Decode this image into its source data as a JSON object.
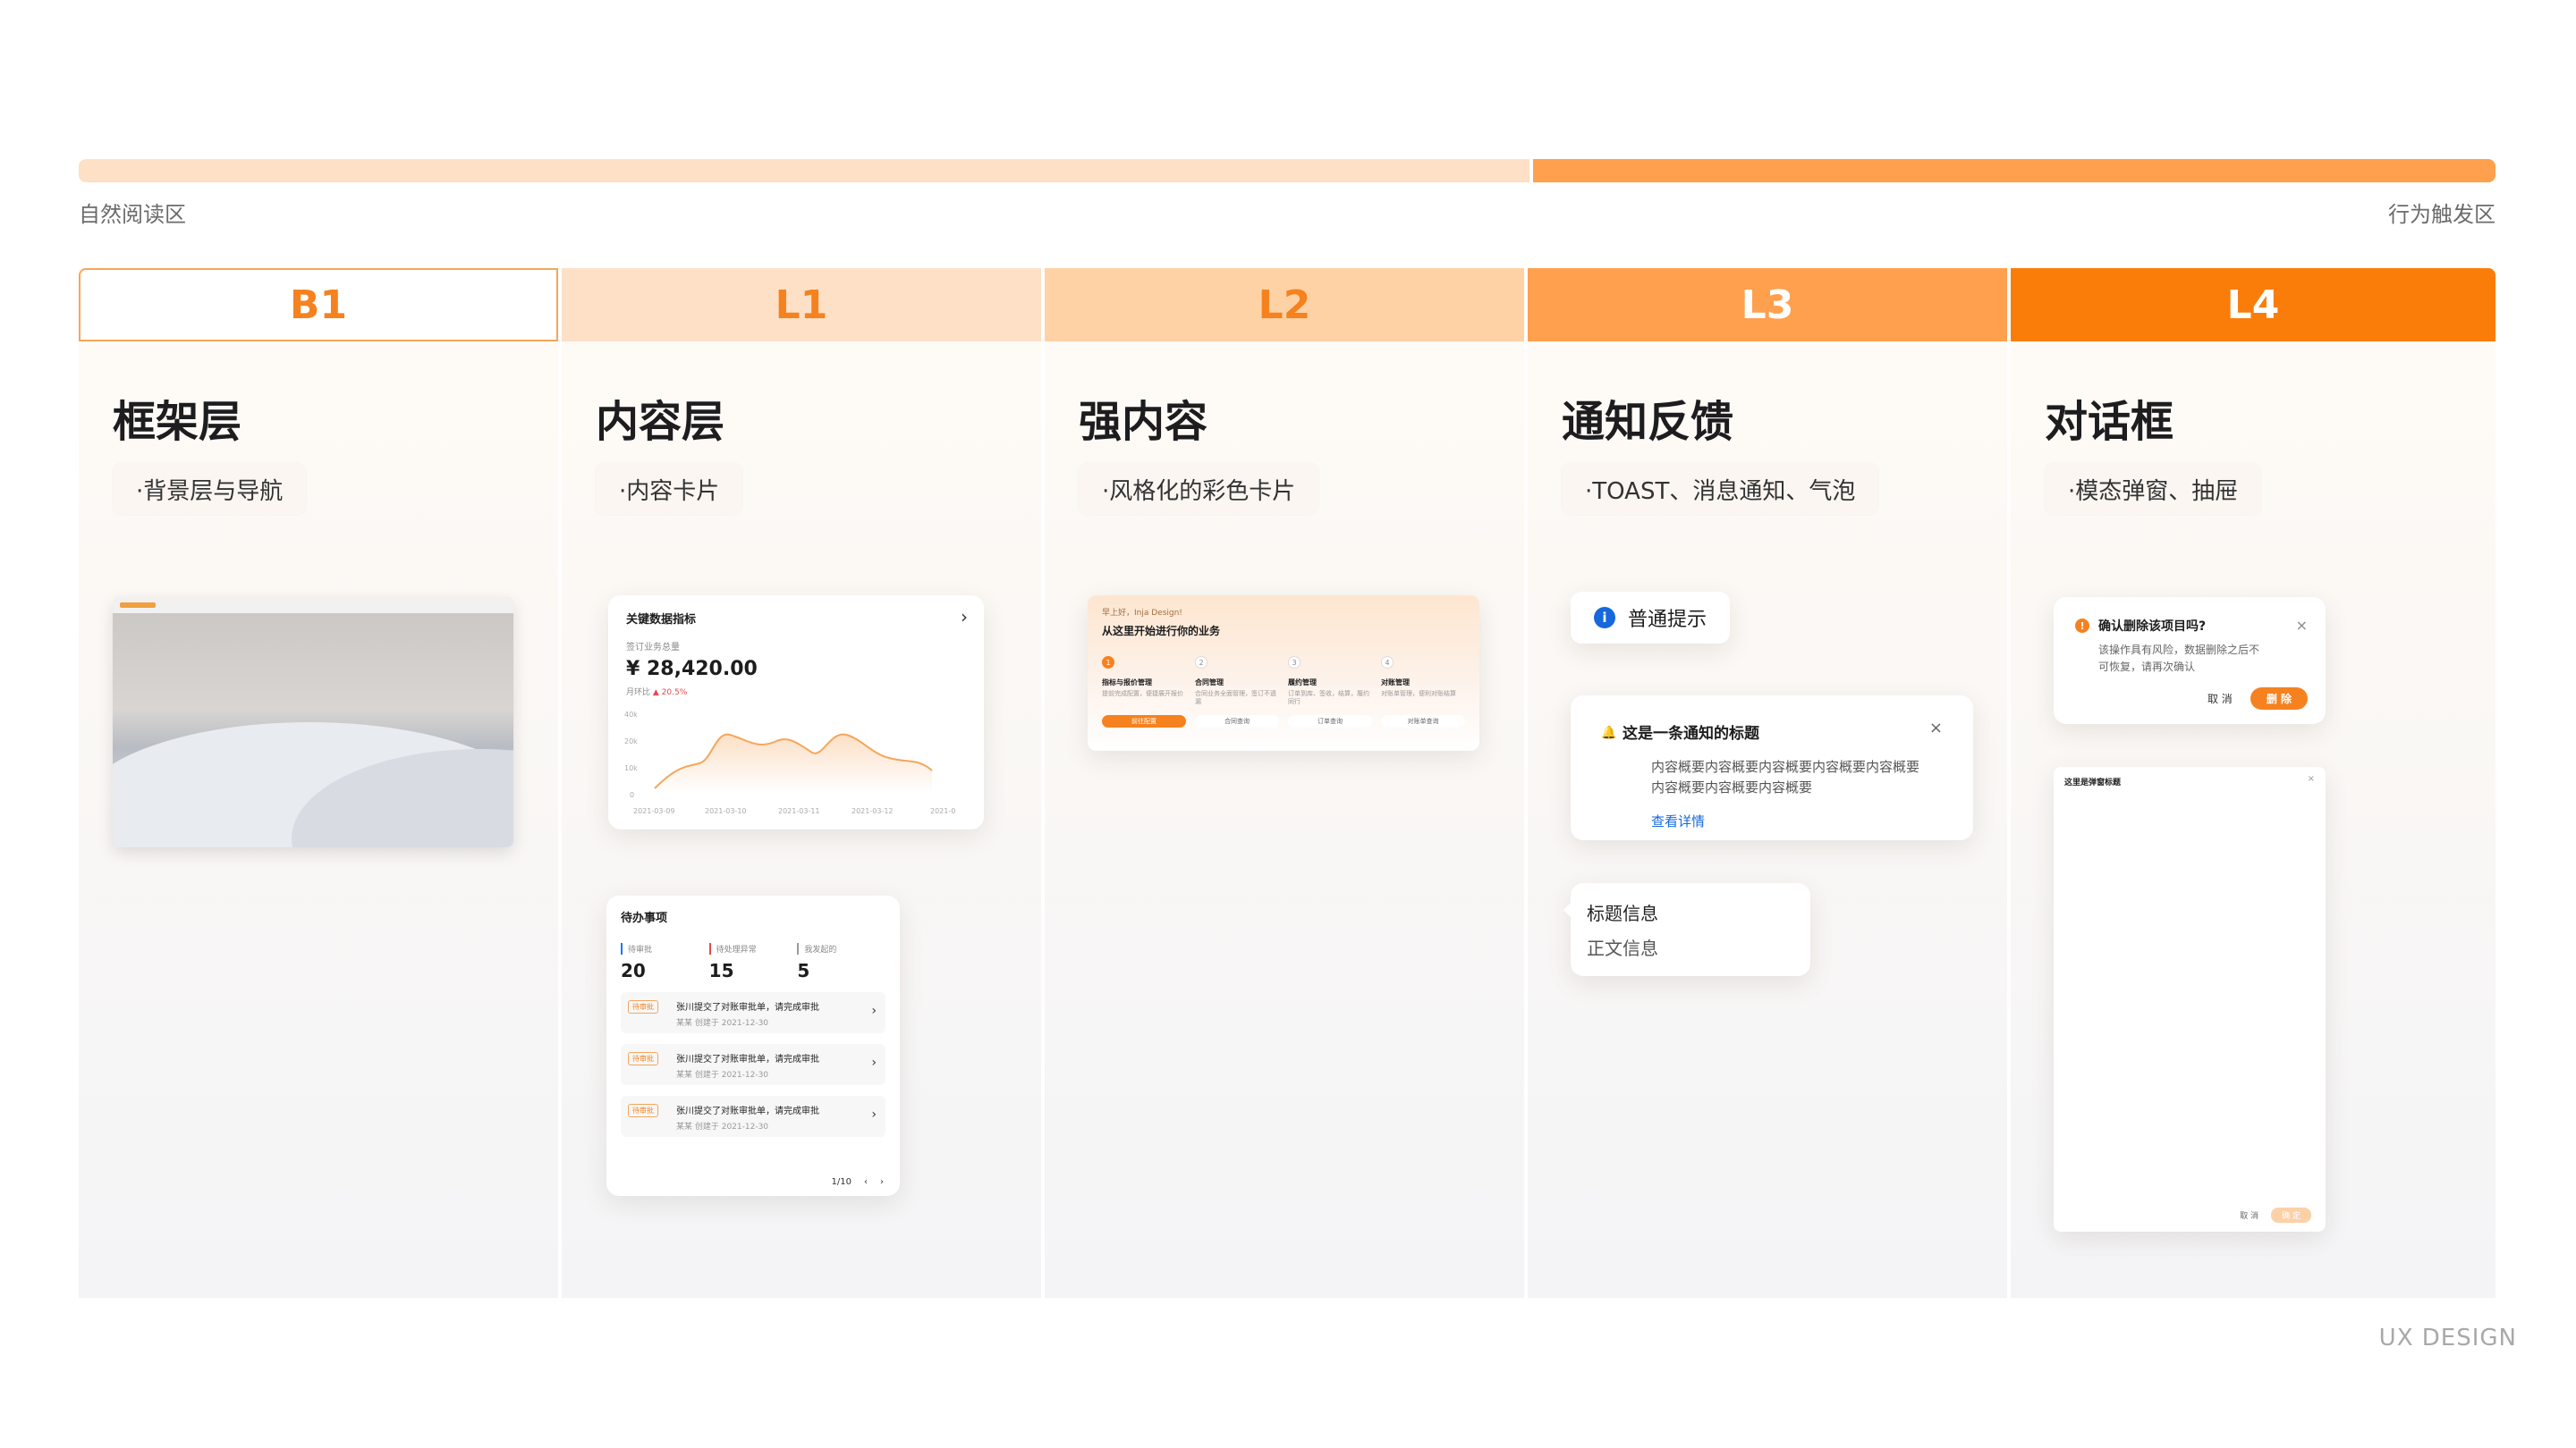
{
  "zone": {
    "left_label": "自然阅读区",
    "right_label": "行为触发区"
  },
  "columns": [
    {
      "key": "B1",
      "title": "框架层",
      "chip": "·背景层与导航",
      "head_bg": "#ffffff",
      "head_fg": "#f5821f"
    },
    {
      "key": "L1",
      "title": "内容层",
      "chip": "·内容卡片",
      "head_bg": "#fde0c6",
      "head_fg": "#f5821f"
    },
    {
      "key": "L2",
      "title": "强内容",
      "chip": "·风格化的彩色卡片",
      "head_bg": "#ffd2a6",
      "head_fg": "#f5821f"
    },
    {
      "key": "L3",
      "title": "通知反馈",
      "chip": "·TOAST、消息通知、气泡",
      "head_bg": "#ffa04e",
      "head_fg": "#ffffff"
    },
    {
      "key": "L4",
      "title": "对话框",
      "chip": "·模态弹窗、抽屉",
      "head_bg": "#fa7d0a",
      "head_fg": "#ffffff"
    }
  ],
  "metric_card": {
    "title": "关键数据指标",
    "label": "签订业务总量",
    "value": "¥ 28,420.00",
    "compare_label": "月环比",
    "compare_value": "▲ 20.5%",
    "y_ticks": [
      "40k",
      "20k",
      "10k",
      "0"
    ],
    "x_ticks": [
      "2021-03-09",
      "2021-03-10",
      "2021-03-11",
      "2021-03-12",
      "2021-0"
    ]
  },
  "todo_card": {
    "title": "待办事项",
    "stats": [
      {
        "label": "待审批",
        "value": "20"
      },
      {
        "label": "待处理异常",
        "value": "15"
      },
      {
        "label": "我发起的",
        "value": "5"
      }
    ],
    "items": [
      {
        "tag": "待审批",
        "title": "张川提交了对账审批单，请完成审批",
        "sub": "某某 创建于 2021-12-30"
      },
      {
        "tag": "待审批",
        "title": "张川提交了对账审批单，请完成审批",
        "sub": "某某 创建于 2021-12-30"
      },
      {
        "tag": "待审批",
        "title": "张川提交了对账审批单，请完成审批",
        "sub": "某某 创建于 2021-12-30"
      }
    ],
    "pager": "1/10"
  },
  "promo_card": {
    "hello": "早上好，Inja Design!",
    "headline": "从这里开始进行你的业务",
    "steps": [
      {
        "num": "1",
        "title": "指标与报价管理",
        "desc": "提前完成配置，便捷展开报价",
        "btn": "前往配置"
      },
      {
        "num": "2",
        "title": "合同管理",
        "desc": "合同业务全面管理，签订不遗漏",
        "btn": "合同查询"
      },
      {
        "num": "3",
        "title": "履约管理",
        "desc": "订单到库、签收，结算，履约同行",
        "btn": "订单查询"
      },
      {
        "num": "4",
        "title": "对账管理",
        "desc": "对账单管理，便利对账结算",
        "btn": "对账单查询"
      }
    ]
  },
  "toast": {
    "text": "普通提示"
  },
  "notification": {
    "title": "这是一条通知的标题",
    "body_line1": "内容概要内容概要内容概要内容概要内容概要",
    "body_line2": "内容概要内容概要内容概要",
    "link": "查看详情"
  },
  "bubble": {
    "title": "标题信息",
    "body": "正文信息"
  },
  "modal": {
    "title": "确认删除该项目吗?",
    "body_line1": "该操作具有风险，数据删除之后不",
    "body_line2": "可恢复，请再次确认",
    "cancel": "取 消",
    "ok": "删 除"
  },
  "drawer": {
    "title": "这里是弹窗标题",
    "cancel": "取 消",
    "ok": "确 定"
  },
  "footer": "UX DESIGN",
  "colors": {
    "accent": "#f5821f",
    "info": "#1668dc"
  }
}
